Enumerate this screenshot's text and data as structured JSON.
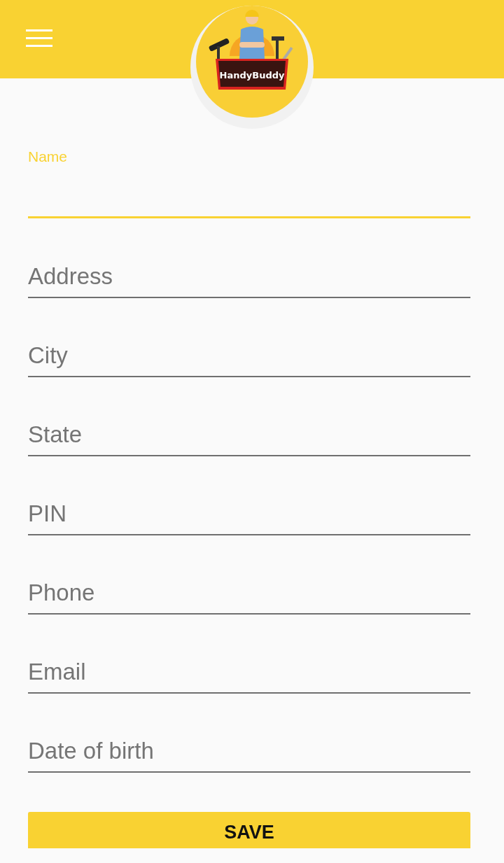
{
  "header": {
    "logo": {
      "text": "HandyBuddy"
    }
  },
  "fields": [
    {
      "label": "Name",
      "focused": true
    },
    {
      "placeholder": "Address",
      "focused": false
    },
    {
      "placeholder": "City",
      "focused": false
    },
    {
      "placeholder": "State",
      "focused": false
    },
    {
      "placeholder": "PIN",
      "focused": false
    },
    {
      "placeholder": "Phone",
      "focused": false
    },
    {
      "placeholder": "Email",
      "focused": false
    },
    {
      "placeholder": "Date of birth",
      "focused": false
    }
  ],
  "save_button": {
    "label": "SAVE"
  }
}
